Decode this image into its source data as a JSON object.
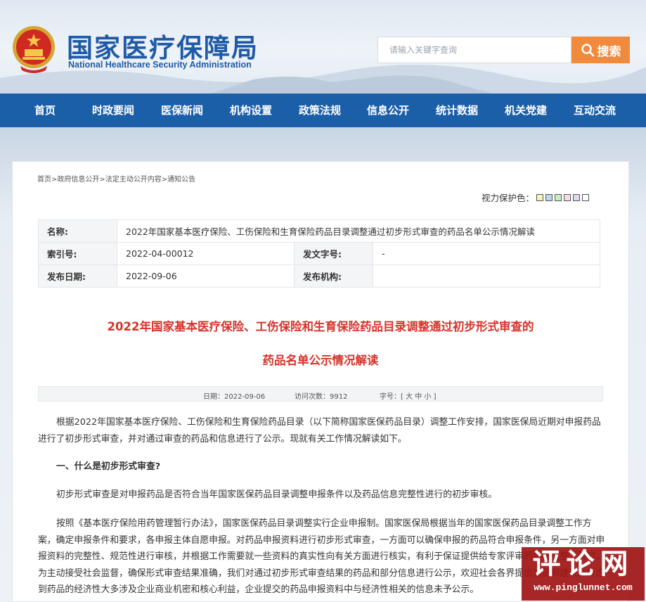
{
  "header": {
    "title_cn": "国家医疗保障局",
    "title_en": "National Healthcare Security Administration",
    "emblem_icon": "national-emblem-icon"
  },
  "search": {
    "placeholder": "请输入关键字查询",
    "button_label": "搜索",
    "icon": "search-icon",
    "button_color": "#f08a3c"
  },
  "nav": {
    "color": "#1c5fa9",
    "items": [
      "首页",
      "时政要闻",
      "医保新闻",
      "机构设置",
      "政策法规",
      "信息公开",
      "统计数据",
      "机关党建",
      "互动交流"
    ]
  },
  "breadcrumb": "首页>政府信息公开>法定主动公开内容>通知公告",
  "vision": {
    "label": "视力保护色：",
    "colors": [
      "#f6f2b8",
      "#bcd6ee",
      "#c8eec4",
      "#f8dbe3",
      "#e2d7f2",
      "#ffffff"
    ]
  },
  "meta": {
    "name_label": "名称:",
    "name_value": "2022年国家基本医疗保险、工伤保险和生育保险药品目录调整通过初步形式审查的药品名单公示情况解读",
    "index_label": "索引号:",
    "index_value": "2022-04-00012",
    "docno_label": "发文字号:",
    "docno_value": "-",
    "date_label": "发布日期:",
    "date_value": "2022-09-06",
    "org_label": "发布机构:",
    "org_value": ""
  },
  "article": {
    "title_line1": "2022年国家基本医疗保险、工伤保险和生育保险药品目录调整通过初步形式审查的",
    "title_line2": "药品名单公示情况解读",
    "title_color": "#d8322a",
    "info_date": "日期：2022-09-06",
    "info_visits": "访问次数：9912",
    "info_font": "字号：[ 大 中 小 ]",
    "p1": "根据2022年国家基本医疗保险、工伤保险和生育保险药品目录（以下简称国家医保药品目录）调整工作安排，国家医保局近期对申报药品进行了初步形式审查，并对通过审查的药品和信息进行了公示。现就有关工作情况解读如下。",
    "h1": "一、什么是初步形式审查?",
    "p2": "初步形式审查是对申报药品是否符合当年国家医保药品目录调整申报条件以及药品信息完整性进行的初步审核。",
    "p3": "按照《基本医疗保险用药管理暂行办法》，国家医保药品目录调整实行企业申报制。国家医保局根据当年的国家医保药品目录调整工作方案，确定申报条件和要求，各申报主体自愿申报。对药品申报资料进行初步形式审查，一方面可以确保申报的药品符合申报条件，另一方面对申报资料的完整性、规范性进行审核，并根据工作需要就一些资料的真实性向有关方面进行核实，有利于保证提供给专家评审的资料完整。同时，为主动接受社会监督，确保形式审查结果准确，我们对通过初步形式审查结果的药品和部分信息进行公示，欢迎社会各界提出意见和建议。考虑到药品的经济性大多涉及企业商业机密和核心利益，企业提交的药品申报资料中与经济性相关的信息未予公示。"
  },
  "watermark": {
    "big": "评论网",
    "small": "www.pinglunnet.com"
  }
}
